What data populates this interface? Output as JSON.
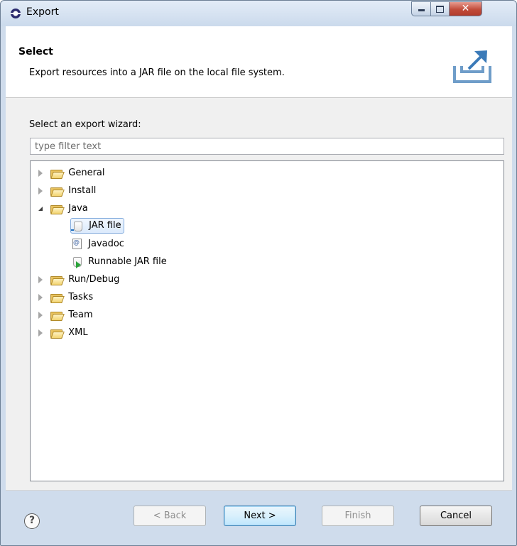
{
  "window": {
    "title": "Export"
  },
  "header": {
    "title": "Select",
    "description": "Export resources into a JAR file on the local file system."
  },
  "filter": {
    "label": "Select an export wizard:",
    "placeholder": "type filter text",
    "value": ""
  },
  "tree": {
    "items": [
      {
        "label": "General",
        "state": "collapsed",
        "icon": "folder-icon"
      },
      {
        "label": "Install",
        "state": "collapsed",
        "icon": "folder-icon"
      },
      {
        "label": "Java",
        "state": "expanded",
        "icon": "folder-icon",
        "children": [
          {
            "label": "JAR file",
            "icon": "jar-icon",
            "selected": true
          },
          {
            "label": "Javadoc",
            "icon": "javadoc-icon"
          },
          {
            "label": "Runnable JAR file",
            "icon": "runnable-jar-icon"
          }
        ]
      },
      {
        "label": "Run/Debug",
        "state": "collapsed",
        "icon": "folder-icon"
      },
      {
        "label": "Tasks",
        "state": "collapsed",
        "icon": "folder-icon"
      },
      {
        "label": "Team",
        "state": "collapsed",
        "icon": "folder-icon"
      },
      {
        "label": "XML",
        "state": "collapsed",
        "icon": "folder-icon"
      }
    ]
  },
  "buttons": {
    "help": "?",
    "back": "< Back",
    "next": "Next >",
    "finish": "Finish",
    "cancel": "Cancel"
  }
}
